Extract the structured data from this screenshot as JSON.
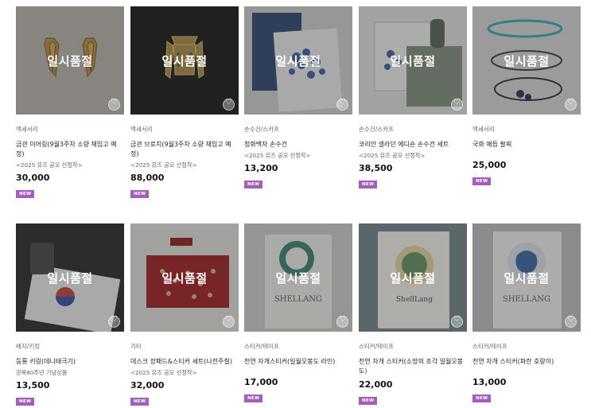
{
  "soldout_label": "일시품절",
  "new_badge": "NEW",
  "products": [
    {
      "category": "액세서리",
      "name": "금관 이어링(9월3주차 소량 재입고 예정)",
      "sub": "<2025 뮤즈 공모 선정작>",
      "price": "30,000",
      "icon": "gold-crown-earrings"
    },
    {
      "category": "액세서리",
      "name": "금관 브로치(9월3주차 소량 재입고 예정)",
      "sub": "<2025 뮤즈 공모 선정작>",
      "price": "88,000",
      "icon": "gold-crown-brooch"
    },
    {
      "category": "손수건/스카프",
      "name": "청화백자 손수건",
      "sub": "<2025 뮤즈 공모 선정작>",
      "price": "13,200",
      "icon": "blue-white-porcelain-handkerchief"
    },
    {
      "category": "손수건/스카프",
      "name": "코리안 셀라던 에디숀 손수건 세트",
      "sub": "<2025 뮤즈 공모 선정작>",
      "price": "38,500",
      "icon": "celadon-handkerchief-set"
    },
    {
      "category": "액세서리",
      "name": "국화 매듭 팔찌",
      "sub": "",
      "price": "25,000",
      "icon": "knot-bracelet"
    },
    {
      "category": "배지/키링",
      "name": "등룡 키링(데니태극기)",
      "sub": "광복80주년 기념상품",
      "price": "13,500",
      "icon": "taegukgi-keyring"
    },
    {
      "category": "기타",
      "name": "데스크 장패드&스티커 세트(나전주칠)",
      "sub": "<2025 뮤즈 공모 선정작>",
      "price": "32,000",
      "icon": "red-desk-pad"
    },
    {
      "category": "스티커/테이프",
      "name": "천연 자개스티커(일월오봉도 라인)",
      "sub": "",
      "price": "17,000",
      "icon": "mother-of-pearl-sticker-1"
    },
    {
      "category": "스티커/테이프",
      "name": "천연 자개 스티커(소망의 조각 일월오봉도)",
      "sub": "",
      "price": "22,000",
      "icon": "mother-of-pearl-sticker-2"
    },
    {
      "category": "스티커/테이프",
      "name": "천연 자개 스티커(파란 호랑이)",
      "sub": "",
      "price": "13,000",
      "icon": "mother-of-pearl-sticker-tiger"
    }
  ]
}
